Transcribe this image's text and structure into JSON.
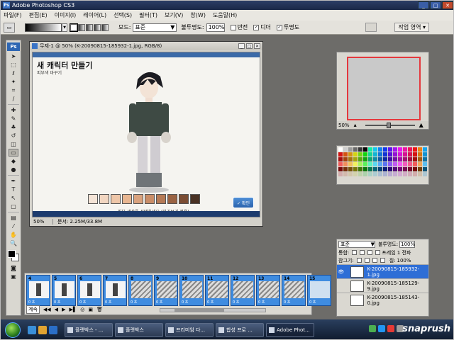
{
  "app": {
    "title": "Adobe Photoshop CS3",
    "badge": "Ps"
  },
  "menu": [
    "파일(F)",
    "편집(E)",
    "이미지(I)",
    "레이어(L)",
    "선택(S)",
    "필터(T)",
    "보기(V)",
    "창(W)",
    "도움말(H)"
  ],
  "options": {
    "mode_label": "모드:",
    "mode_value": "표준",
    "opacity_label": "불투명도:",
    "opacity_value": "100%",
    "reverse_label": "반전",
    "dither_label": "디더",
    "transparency_label": "투명도",
    "workspace_label": "작업 영역 ▾"
  },
  "document": {
    "title": "무제-1 @ 50% (K-20090815-185932-1.jpg, RGB/8)",
    "canvas_heading": "새 캐릭터 만들기",
    "canvas_sub": "피부색 바꾸기",
    "hint": "피부 색상을 선택하세요 (미리보기 적용)",
    "ok_label": "✓ 확인",
    "zoom": "50%",
    "doc_info": "문서: 2.25M/33.8M"
  },
  "skin_colors": [
    "#f4e4d7",
    "#f2d6c1",
    "#eec6a8",
    "#e8b691",
    "#d9a27e",
    "#c98d68",
    "#b57a56",
    "#9a6343",
    "#7b4d34",
    "#4a3224"
  ],
  "navigator": {
    "zoom": "50%"
  },
  "layers": {
    "blend_mode": "표준",
    "opacity_label": "불투명도:",
    "opacity_value": "100%",
    "unify_label": "통합:",
    "propagate_label": "프레임 1 전파",
    "lock_label": "잠그기:",
    "fill_label": "칠:",
    "fill_value": "100%",
    "items": [
      {
        "name": "K-20090815-185932-1.jpg",
        "active": true
      },
      {
        "name": "K-20090815-185129-9.jpg",
        "active": false
      },
      {
        "name": "K-20090815-185143-0.jpg",
        "active": false
      }
    ]
  },
  "animation": {
    "frames": [
      {
        "num": "4",
        "delay": "0 초",
        "kind": "char"
      },
      {
        "num": "5",
        "delay": "0 초",
        "kind": "char"
      },
      {
        "num": "6",
        "delay": "0 초",
        "kind": "char"
      },
      {
        "num": "7",
        "delay": "0 초",
        "kind": "char"
      },
      {
        "num": "8",
        "delay": "0 초",
        "kind": "blank"
      },
      {
        "num": "9",
        "delay": "0 초",
        "kind": "blank"
      },
      {
        "num": "10",
        "delay": "0 초",
        "kind": "blank"
      },
      {
        "num": "11",
        "delay": "0 초",
        "kind": "blank"
      },
      {
        "num": "12",
        "delay": "0 초",
        "kind": "blank"
      },
      {
        "num": "13",
        "delay": "0 초",
        "kind": "blank"
      },
      {
        "num": "14",
        "delay": "0 초",
        "kind": "blank"
      },
      {
        "num": "15",
        "delay": "0 초",
        "kind": "shot"
      }
    ],
    "loop": "계속"
  },
  "taskbar": {
    "tasks": [
      {
        "label": "플랫박스 - ...",
        "active": false
      },
      {
        "label": "플랫박스",
        "active": false
      },
      {
        "label": "프리미엄 다...",
        "active": false
      },
      {
        "label": "합성 프로 ...",
        "active": false
      },
      {
        "label": "Adobe Phot...",
        "active": true
      }
    ],
    "watermark": "snaprush"
  }
}
